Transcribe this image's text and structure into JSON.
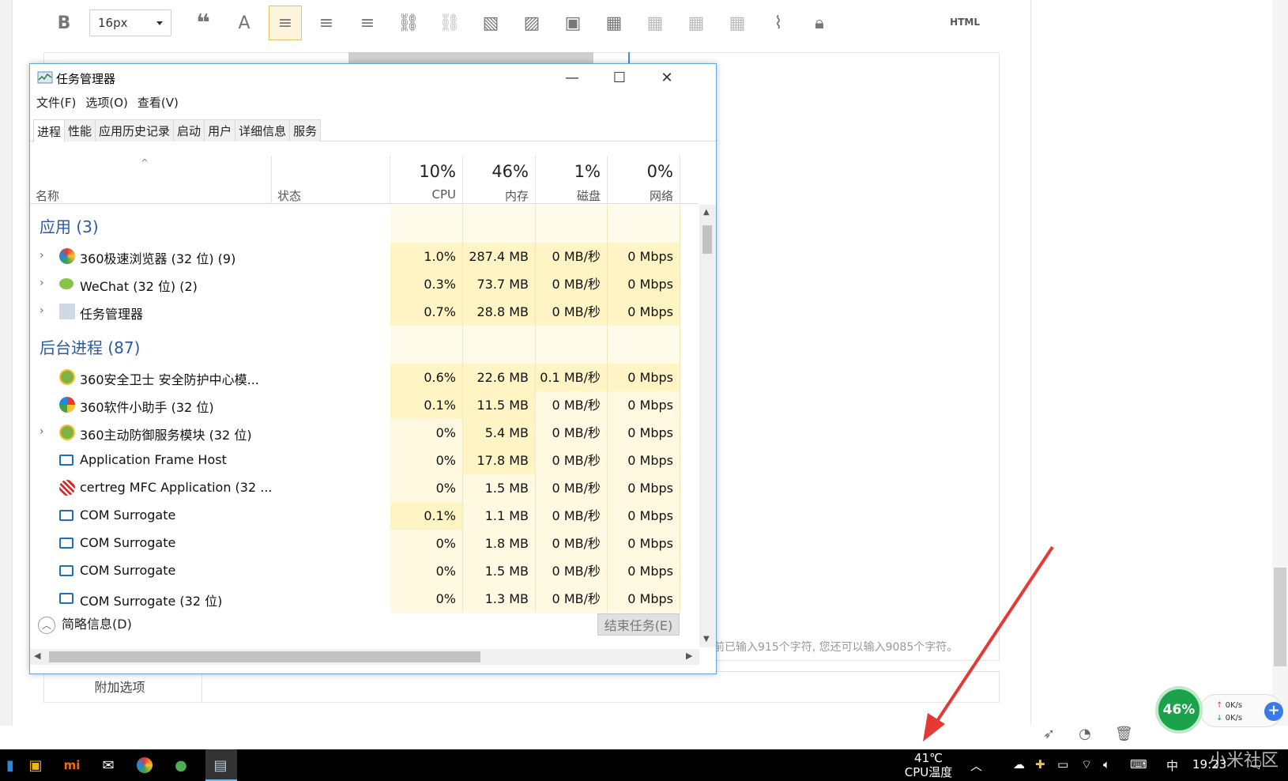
{
  "editor": {
    "font_size": "16px",
    "html_label": "HTML",
    "char_count": "前已输入915个字符, 您还可以输入9085个字符。",
    "extra_options": "附加选项"
  },
  "task_manager": {
    "title": "任务管理器",
    "menu": [
      "文件(F)",
      "选项(O)",
      "查看(V)"
    ],
    "tabs": [
      "进程",
      "性能",
      "应用历史记录",
      "启动",
      "用户",
      "详细信息",
      "服务"
    ],
    "columns": {
      "name": "名称",
      "status": "状态",
      "cpu_pct": "10%",
      "cpu": "CPU",
      "mem_pct": "46%",
      "mem": "内存",
      "disk_pct": "1%",
      "disk": "磁盘",
      "net_pct": "0%",
      "net": "网络"
    },
    "group_apps": "应用 (3)",
    "apps": [
      {
        "name": "360极速浏览器 (32 位) (9)",
        "cpu": "1.0%",
        "mem": "287.4 MB",
        "disk": "0 MB/秒",
        "net": "0 Mbps"
      },
      {
        "name": "WeChat (32 位) (2)",
        "cpu": "0.3%",
        "mem": "73.7 MB",
        "disk": "0 MB/秒",
        "net": "0 Mbps"
      },
      {
        "name": "任务管理器",
        "cpu": "0.7%",
        "mem": "28.8 MB",
        "disk": "0 MB/秒",
        "net": "0 Mbps"
      }
    ],
    "group_bg": "后台进程 (87)",
    "bg": [
      {
        "name": "360安全卫士 安全防护中心模...",
        "cpu": "0.6%",
        "mem": "22.6 MB",
        "disk": "0.1 MB/秒",
        "net": "0 Mbps"
      },
      {
        "name": "360软件小助手 (32 位)",
        "cpu": "0.1%",
        "mem": "11.5 MB",
        "disk": "0 MB/秒",
        "net": "0 Mbps"
      },
      {
        "name": "360主动防御服务模块 (32 位)",
        "cpu": "0%",
        "mem": "5.4 MB",
        "disk": "0 MB/秒",
        "net": "0 Mbps"
      },
      {
        "name": "Application Frame Host",
        "cpu": "0%",
        "mem": "17.8 MB",
        "disk": "0 MB/秒",
        "net": "0 Mbps"
      },
      {
        "name": "certreg MFC Application (32 ...",
        "cpu": "0%",
        "mem": "1.5 MB",
        "disk": "0 MB/秒",
        "net": "0 Mbps"
      },
      {
        "name": "COM Surrogate",
        "cpu": "0.1%",
        "mem": "1.1 MB",
        "disk": "0 MB/秒",
        "net": "0 Mbps"
      },
      {
        "name": "COM Surrogate",
        "cpu": "0%",
        "mem": "1.8 MB",
        "disk": "0 MB/秒",
        "net": "0 Mbps"
      },
      {
        "name": "COM Surrogate",
        "cpu": "0%",
        "mem": "1.5 MB",
        "disk": "0 MB/秒",
        "net": "0 Mbps"
      },
      {
        "name": "COM Surrogate (32 位)",
        "cpu": "0%",
        "mem": "1.3 MB",
        "disk": "0 MB/秒",
        "net": "0 Mbps"
      }
    ],
    "brief": "简略信息(D)",
    "end_task": "结束任务(E)"
  },
  "widget": {
    "percent": "46%",
    "up": "0K/s",
    "down": "0K/s"
  },
  "taskbar": {
    "temp": "41℃",
    "temp_label": "CPU温度",
    "ime": "中",
    "time": "19:23",
    "watermark": "小米社区"
  }
}
